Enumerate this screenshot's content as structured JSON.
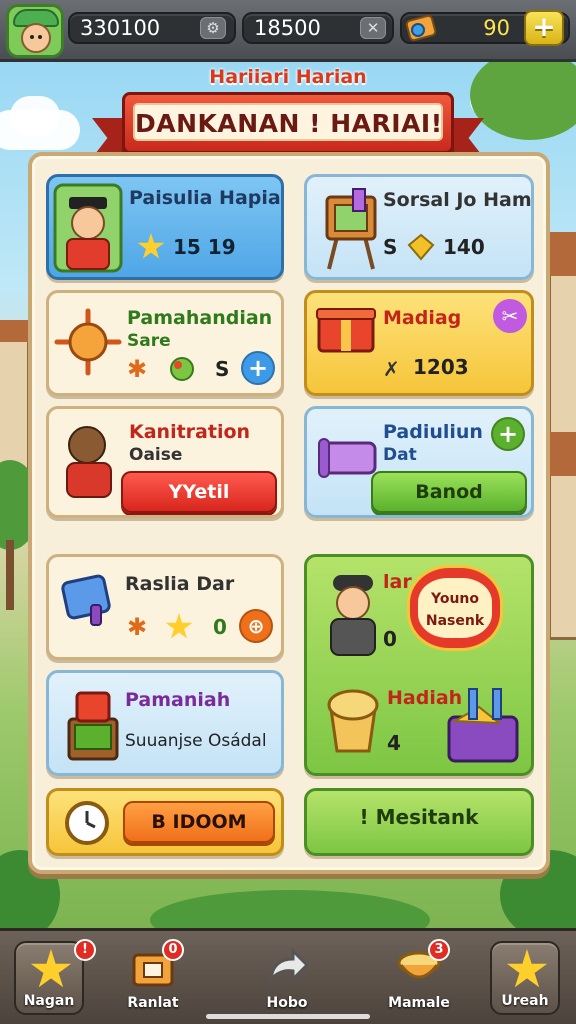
{
  "topbar": {
    "coins": "330100",
    "coins_button_icon": "gear-icon",
    "gold": "18500",
    "gold_button_icon": "close-icon",
    "gems": "90",
    "add_label": "+"
  },
  "header": {
    "subtitle": "Hariiari Harian",
    "title": "DANKANAN ! HARIAI!"
  },
  "cards": {
    "c1": {
      "title": "Paisulia Hapian",
      "value": "15 19"
    },
    "c2": {
      "title": "Sorsal Jo Ham",
      "prefix": "S",
      "value": "140"
    },
    "c3": {
      "title": "Pamahandian",
      "subtitle": "Sare",
      "value": "S",
      "plus": "+"
    },
    "c4": {
      "title": "Madiag",
      "value": "1203"
    },
    "c5": {
      "title": "Kanitration",
      "subtitle": "Oaise",
      "button": "YYetil"
    },
    "c6": {
      "title": "Padiuliun",
      "subtitle": "Dat",
      "button": "Banod",
      "plus": "+"
    },
    "c7": {
      "title": "Raslia Dar",
      "value": "0"
    },
    "c8": {
      "title": "lar",
      "badge": "Youno\nNasenk",
      "value1": "0",
      "title2": "Hadiah",
      "value2": "4"
    },
    "c9": {
      "title": "Pamaniah",
      "subtitle": "Suuanjse Osádal"
    },
    "c10": {
      "button": "B IDOOM"
    },
    "c11": {
      "button": "! Mesitank"
    }
  },
  "nav": {
    "items": [
      {
        "label": "Nagan",
        "badge": "!"
      },
      {
        "label": "Ranlat",
        "badge": "0"
      },
      {
        "label": "Hobo"
      },
      {
        "label": "Mamale",
        "badge": "3"
      },
      {
        "label": "Ureah"
      }
    ]
  },
  "colors": {
    "accent_red": "#d9261d",
    "accent_green": "#5bb12d",
    "accent_yellow": "#f6c53a",
    "accent_blue": "#4fa6e6",
    "panel_bg": "#f7efd9"
  }
}
